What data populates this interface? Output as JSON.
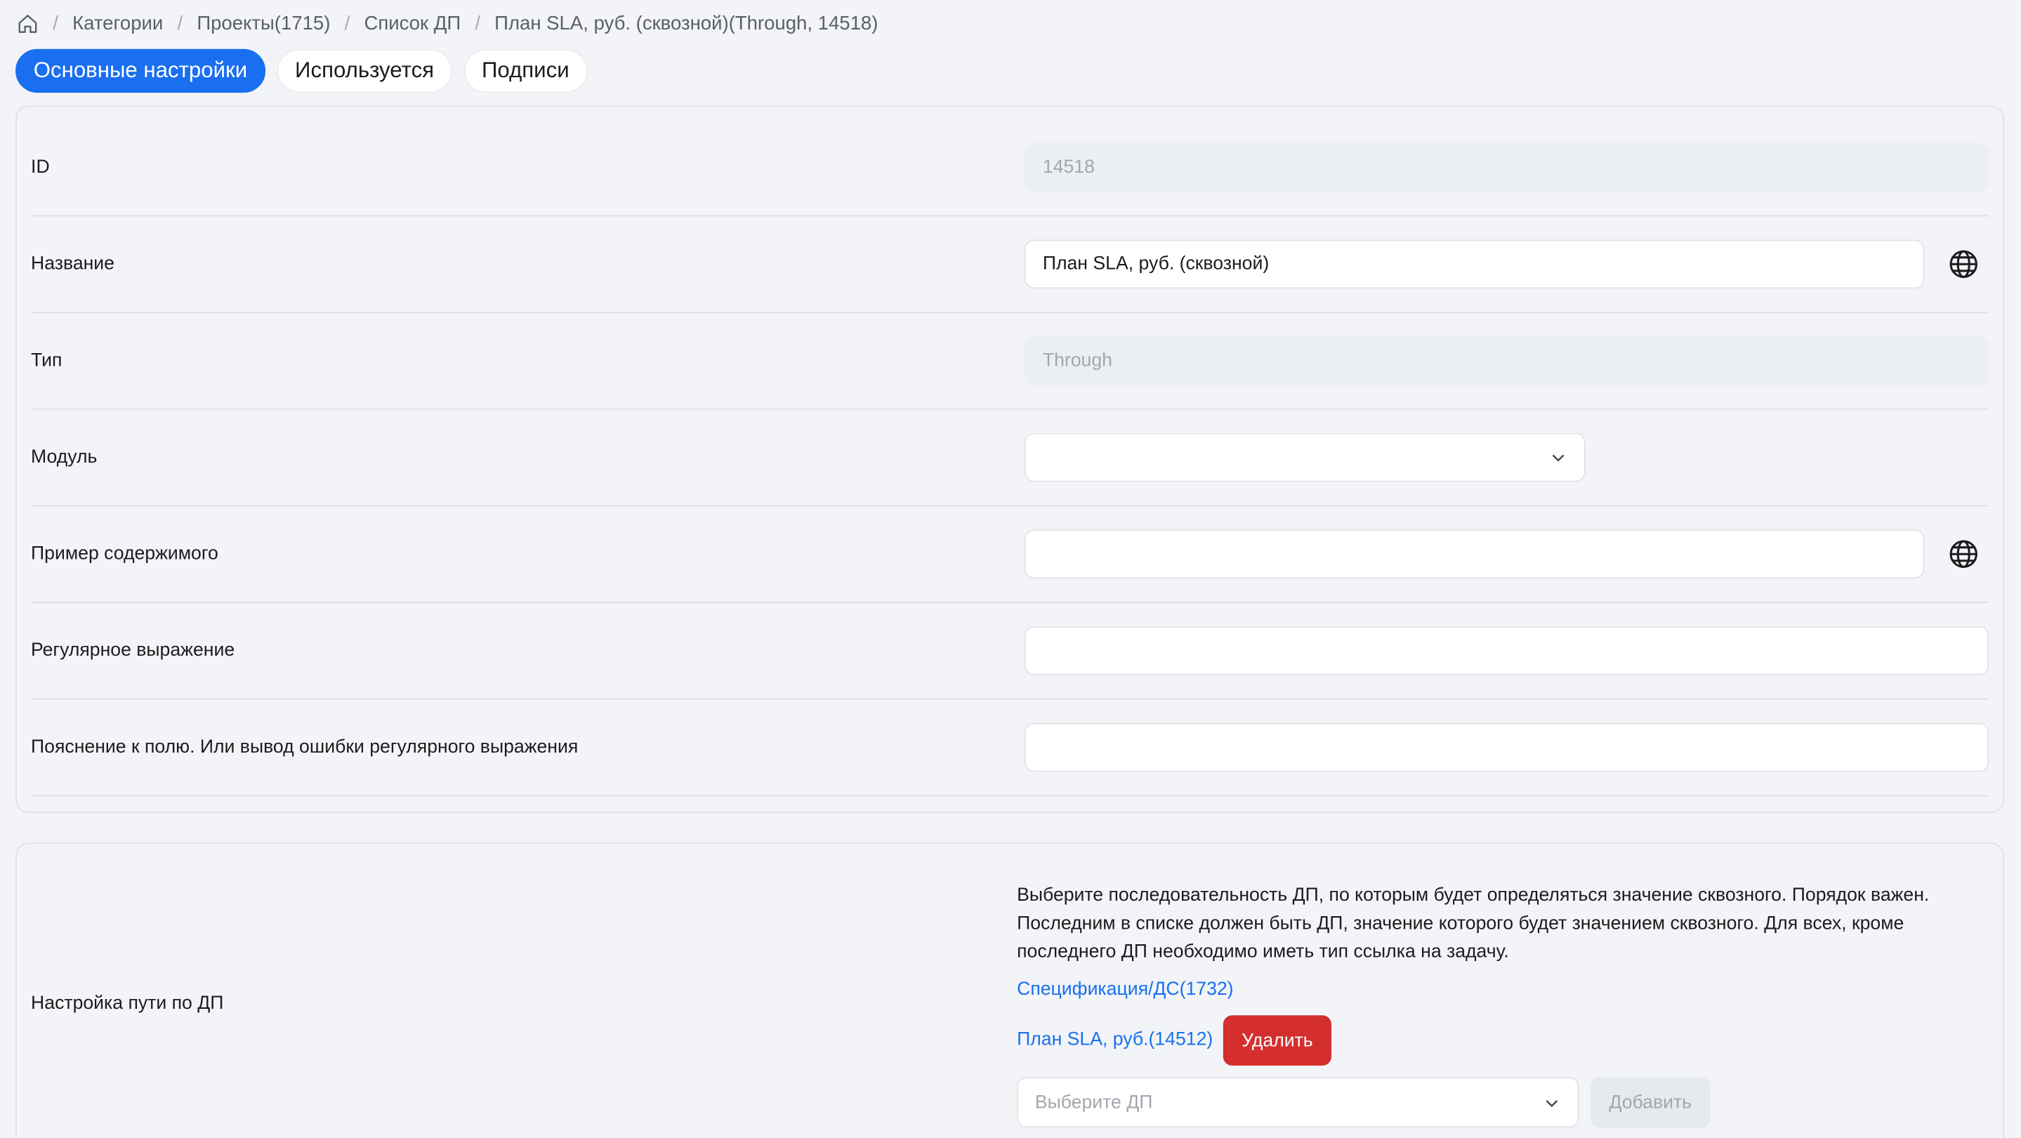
{
  "breadcrumb": {
    "home_icon": "home-icon",
    "items": [
      "Категории",
      "Проекты(1715)",
      "Список ДП",
      "План SLA, руб. (сквозной)(Through, 14518)"
    ]
  },
  "tabs": [
    "Основные настройки",
    "Используется",
    "Подписи"
  ],
  "active_tab": "Основные настройки",
  "form": {
    "id": {
      "label": "ID",
      "value": "14518"
    },
    "name": {
      "label": "Название",
      "value": "План SLA, руб. (сквозной)",
      "icon": "globe-icon"
    },
    "type": {
      "label": "Тип",
      "value": "Through"
    },
    "module": {
      "label": "Модуль",
      "value": ""
    },
    "example": {
      "label": "Пример содержимого",
      "value": "",
      "icon": "globe-icon"
    },
    "regex": {
      "label": "Регулярное выражение",
      "value": ""
    },
    "hint": {
      "label": "Пояснение к полю. Или вывод ошибки регулярного выражения",
      "value": ""
    }
  },
  "path": {
    "label": "Настройка пути по ДП",
    "description": "Выберите последовательность ДП, по которым будет определяться значение сквозного. Порядок важен. Последним в списке должен быть ДП, значение которого будет значением сквозного. Для всех, кроме последнего ДП необходимо иметь тип ссылка на задачу.",
    "links": [
      "Спецификация/ДС(1732)",
      "План SLA, руб.(14512)"
    ],
    "delete_label": "Удалить",
    "select_placeholder": "Выберите ДП",
    "add_label": "Добавить"
  },
  "colors": {
    "accent": "#1a6ff0",
    "danger": "#d42e2e"
  }
}
